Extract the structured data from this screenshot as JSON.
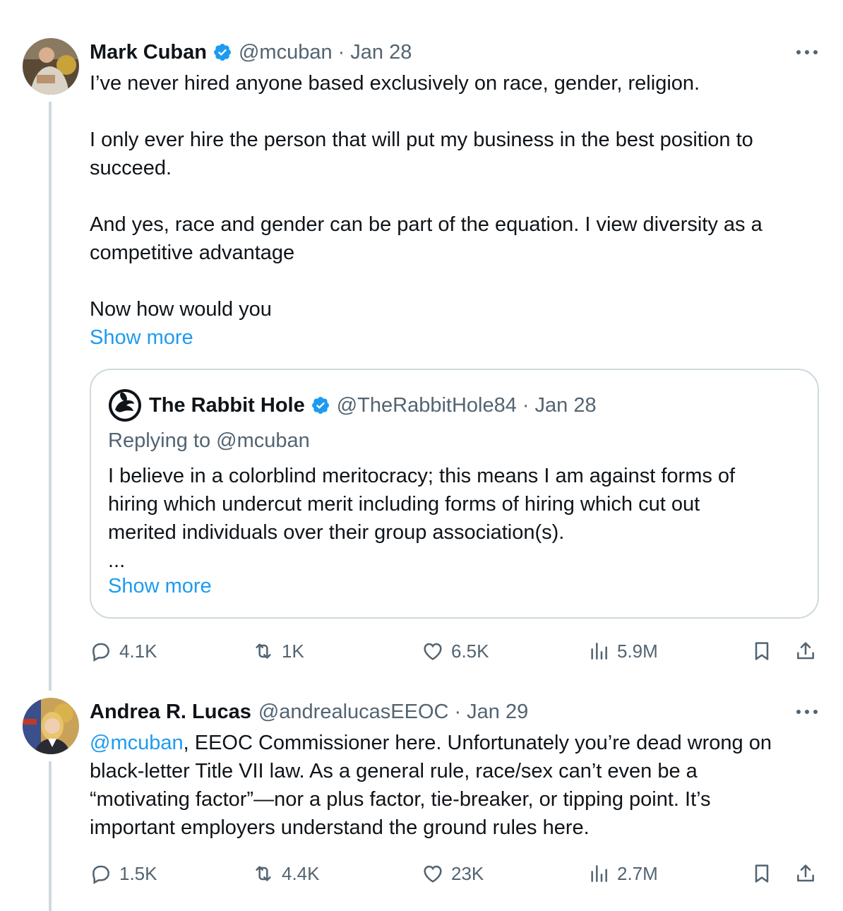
{
  "tweets": [
    {
      "name": "Mark Cuban",
      "handle": "@mcuban",
      "sep": "·",
      "date": "Jan 28",
      "paragraphs": [
        "I’ve never hired anyone based exclusively on race, gender, religion.",
        "I only ever hire the person that will put my business in the best position to\nsucceed.",
        "And yes, race and gender can be part of the equation. I view diversity as a\ncompetitive advantage",
        "Now how would you"
      ],
      "show_more": "Show more",
      "quote": {
        "name": "The Rabbit Hole",
        "handle": "@TheRabbitHole84",
        "sep": "·",
        "date": "Jan 28",
        "replying_to": "Replying to @mcuban",
        "text": "I believe in a colorblind meritocracy; this means I am against forms of\nhiring which undercut merit including forms of hiring which cut out\nmerited individuals over their group association(s).",
        "ellipsis": "...",
        "show_more": "Show more"
      },
      "stats": {
        "replies": "4.1K",
        "reposts": "1K",
        "likes": "6.5K",
        "views": "5.9M"
      }
    },
    {
      "name": "Andrea R. Lucas",
      "handle": "@andrealucasEEOC",
      "sep": "·",
      "date": "Jan 29",
      "mention": "@mcuban",
      "text_after_mention": ", EEOC Commissioner here. Unfortunately you’re dead wrong on\nblack-letter Title VII law. As a general rule, race/sex can’t even be a\n“motivating factor”—nor a plus factor, tie-breaker, or tipping point.  It’s\nimportant employers understand the ground rules here.",
      "stats": {
        "replies": "1.5K",
        "reposts": "4.4K",
        "likes": "23K",
        "views": "2.7M"
      }
    }
  ],
  "icons": {
    "verified": "verified-badge-icon",
    "more": "more-options-icon",
    "reply": "reply-icon",
    "repost": "repost-icon",
    "like": "heart-icon",
    "views": "views-icon",
    "bookmark": "bookmark-icon",
    "share": "share-icon"
  },
  "colors": {
    "link": "#1d9bf0",
    "secondary_text": "#536471",
    "border": "#cfd9de"
  }
}
